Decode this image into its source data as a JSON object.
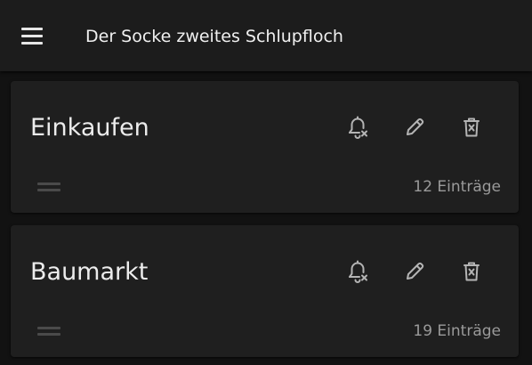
{
  "app": {
    "title": "Der Socke zweites Schlupfloch",
    "menu_icon": "hamburger-menu-icon"
  },
  "lists": [
    {
      "name": "Einkaufen",
      "count": "12 Einträge",
      "icons": [
        "bell-off-icon",
        "pencil-icon",
        "trash-icon",
        "drag-handle-icon"
      ]
    },
    {
      "name": "Baumarkt",
      "count": "19 Einträge",
      "icons": [
        "bell-off-icon",
        "pencil-icon",
        "trash-icon",
        "drag-handle-icon"
      ]
    }
  ],
  "colors": {
    "background": "#121212",
    "surface": "#1f1f1f",
    "topbar": "#1c1c1c",
    "text": "#ececec",
    "icon": "#b4b4b4",
    "muted_text": "#9a9a9a"
  }
}
